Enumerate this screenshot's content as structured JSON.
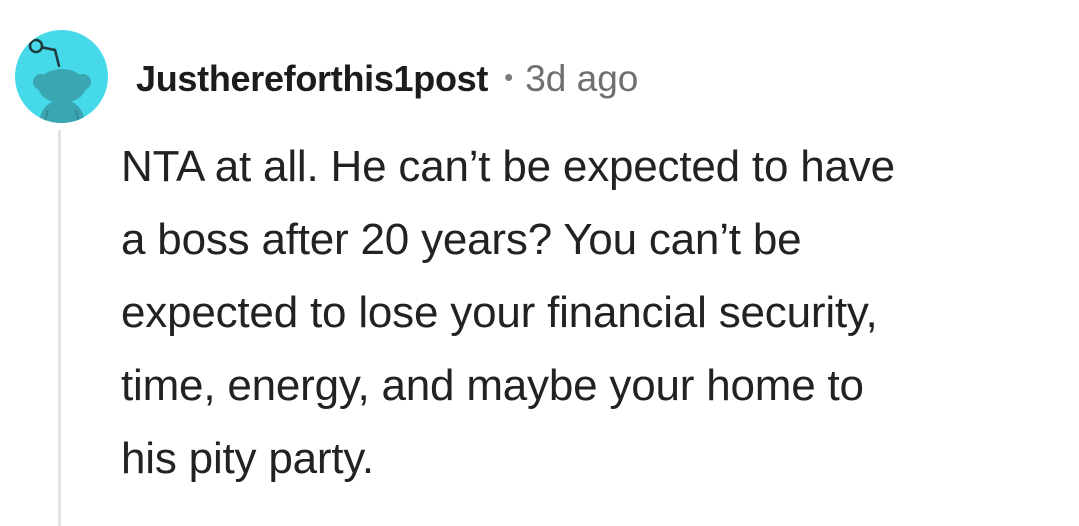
{
  "comment": {
    "author": "Justhereforthis1post",
    "separator": "•",
    "timestamp": "3d ago",
    "avatar_icon": "snoo-avatar-icon",
    "body_lines": [
      "NTA at all. He can’t be expected to have",
      "a boss after 20 years? You can’t be",
      "expected to lose your financial security,",
      "time, energy, and maybe your home to",
      "his pity party."
    ]
  },
  "colors": {
    "avatar_background": "#46d9ea",
    "avatar_figure": "#3aa6b2",
    "thread_line": "#e3e3e3",
    "timestamp": "#6f6f6f"
  }
}
